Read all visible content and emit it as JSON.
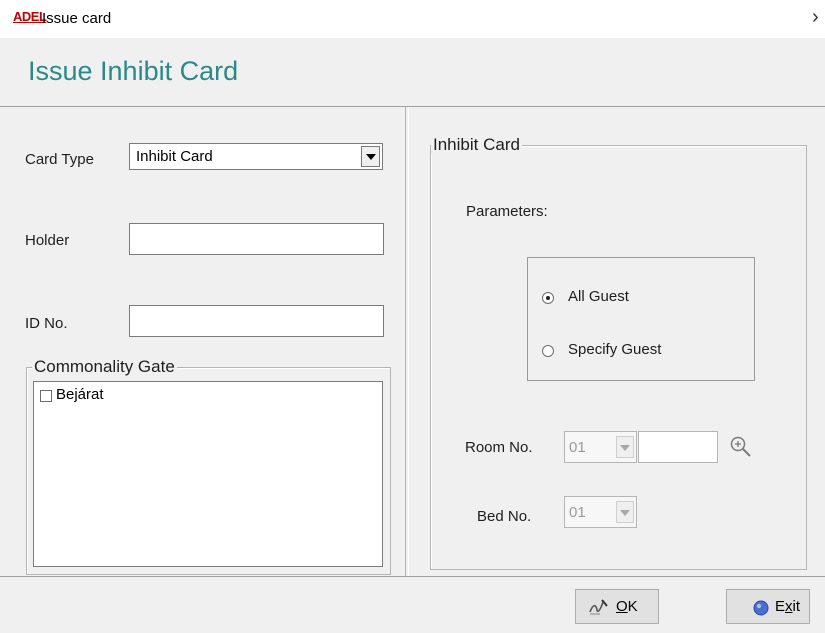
{
  "window": {
    "logo_text": "ADEL",
    "title": "Issue card"
  },
  "header": {
    "title": "Issue Inhibit Card"
  },
  "form": {
    "card_type_label": "Card Type",
    "card_type_value": "Inhibit Card",
    "holder_label": "Holder",
    "holder_value": "",
    "id_label": "ID No.",
    "id_value": "",
    "commonality_gate": {
      "label": "Commonality Gate",
      "items": [
        {
          "label": "Bejárat",
          "checked": false
        }
      ]
    }
  },
  "inhibit_card": {
    "group_label": "Inhibit Card",
    "parameters_label": "Parameters:",
    "options": [
      {
        "label": "All Guest",
        "selected": true
      },
      {
        "label": "Specify Guest",
        "selected": false
      }
    ],
    "room_label": "Room No.",
    "room_value": "01",
    "room_text": "",
    "bed_label": "Bed No.",
    "bed_value": "01"
  },
  "buttons": {
    "ok_mnemonic": "O",
    "ok_rest": "K",
    "exit_first": "E",
    "exit_mnemonic": "x",
    "exit_rest": "it"
  },
  "colors": {
    "header_title": "#2a8a8a",
    "logo": "#c40000",
    "exit_icon": "#4a6fd1"
  }
}
